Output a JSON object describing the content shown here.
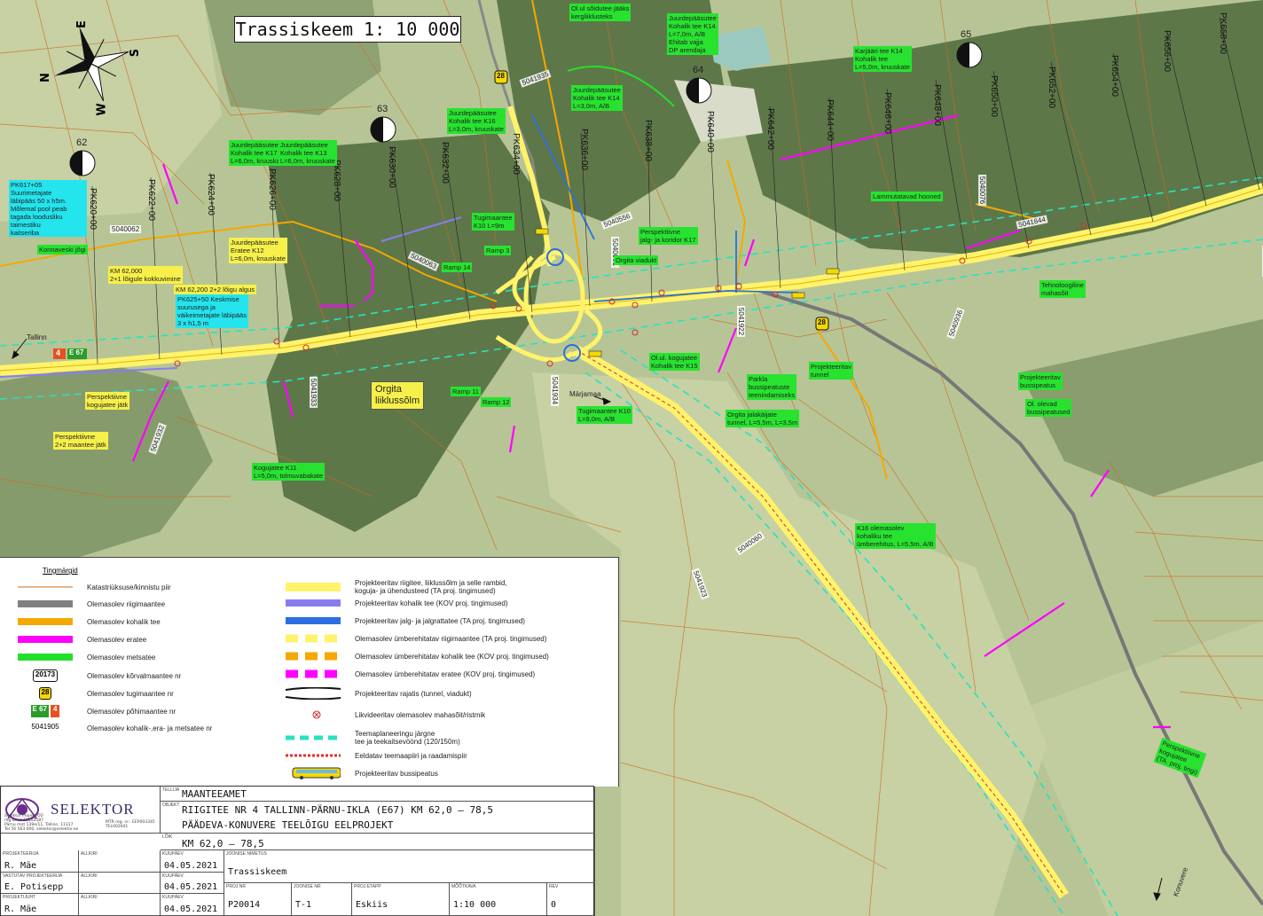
{
  "title": "Trassiskeem 1: 10 000",
  "compass": {
    "n": "N",
    "e": "E",
    "s": "S",
    "w": "W"
  },
  "sheets": [
    "62",
    "63",
    "64",
    "65"
  ],
  "pk_labels": [
    "PK620+00",
    "PK622+00",
    "PK624+00",
    "PK626+00",
    "PK628+00",
    "PK630+00",
    "PK632+00",
    "PK634+00",
    "PK636+00",
    "PK638+00",
    "PK640+00",
    "PK642+00",
    "PK644+00",
    "PK646+00",
    "PK648+00",
    "PK650+00",
    "PK652+00",
    "PK654+00",
    "PK656+00",
    "PK658+00"
  ],
  "road_numbers": [
    "5040062",
    "5040063",
    "5041935",
    "5040556",
    "5041844",
    "5040076",
    "5040061",
    "5041921",
    "5041932",
    "5041933",
    "5041934",
    "5040060",
    "5040936",
    "5041922",
    "5041923"
  ],
  "labels": {
    "pk617": "PK617+05\nSuurimetajate\nläbipääs 50 x h5m.\nMõlemal pool peab\ntagada loodusliku\ntaimestiku\nkaitseriba",
    "konnaveski": "Konnaveski jõgi",
    "km62000": "KM 62,000\n2+1 lõigule kokkuvimine",
    "km62200": "KM 62,200 2+2 lõigu algus",
    "pk625": "PK625+50 Keskmise\nsuurusega ja\nväikeimetajate läbipääs\n3 x h1,5 m",
    "k17a": "Juurdepääsutee\nKohalik tee K17\nL=6,0m, kruuskate",
    "k13": "Juurdepääsutee\nKohalik tee K13\nL=6,0m, kruuskate",
    "k12": "Juurdepääsutee\nEratee K12\nL=6,0m, kruuskate",
    "k16b": "Juurdepääsutee\nKohalik tee K16\nL=3,0m, kruuskate",
    "k14": "Juurdepääsutee\nKohalik tee K14\nL=3,0m, A/B",
    "k14b": "Juurdepääsutee\nKohalik tee K14\nL=7,0m, A/B\nEhitab vajja\nDP arendaja",
    "olul": "Ol.ul sõidutee jääks\nkergliiklusteks",
    "karjaari": "Karjääri tee K14\nKohalik tee\nL=5,0m, kruuskate",
    "tugimaantee": "Tugimaantee\nK10 L=9m",
    "ramp3": "Ramp 3",
    "ramp14": "Ramp 14",
    "perspektiivne_jalg": "Perspektiivne\njalg- ja koridor K17",
    "orgita_viadukt": "Orgita viadukt",
    "lammutatavad": "Lammutatavad hooned",
    "tehnoloogiline": "Tehnoloogiline\nmahasõit",
    "orgita_liiklus": "Orgita\nliiklussõlm",
    "ramp11": "Ramp 11",
    "ramp12": "Ramp 12",
    "tugimaantee_k10": "Tugimaantee K10\nL=9,0m, A/B",
    "kogujatee_k11": "Kogujatee K11\nL=5,0m, tolmuvabakate",
    "olul_kogujatee": "Ol.ul. kogujatee\nKohalik tee K15",
    "parkla": "Parkla\nbussipeatuste\nteenindamiseks",
    "projekteeritav_tunnel": "Projekteeritav\ntunnel",
    "orgita_jala": "Orgita jalakäijate\ntunnel, L=5,5m, L=3,5m",
    "projekteeritav_bp": "Projekteeritav\nbussipeatus",
    "ol_olevad": "Ol. olevad\nbussipeatused",
    "k16": "K16 olemasolev\nkohaliku tee\nümberehitus, L=5,5m, A/B",
    "perspektiivne_kogujatee": "Perspektiivne\nkogujatee jätk",
    "perspektiivne_2p2": "Perspektiivne\n2+2 maantee jätk",
    "perspektiivne_kv": "Perspektiivne\nkogujatee\n(TA. proj. tingi)",
    "tallinn": "Tallinn",
    "marjamaa": "Märjamaa",
    "konuvere": "Konuvere",
    "e67": "E 67",
    "n4": "4",
    "n28": "28"
  },
  "legend": {
    "header": "Tingmärgid",
    "left": [
      "Katastriüksuse/kinnistu piir",
      "Olemasolev riigimaantee",
      "Olemasolev kohalik tee",
      "Olemasolev eratee",
      "Olemasolev metsatee",
      "Olemasolev kõrvalmaantee nr",
      "Olemasolev tugimaantee nr",
      "Olemasolev põhimaantee nr",
      "Olemasolev kohalik-,era- ja metsatee nr"
    ],
    "left_symbols": [
      "",
      "",
      "",
      "",
      "",
      "20173",
      "28",
      "E 67",
      "5041905"
    ],
    "right": [
      "Projekteeritav riigitee, liiklussõlm ja selle rambid,\nkoguja- ja ühendusteed (TA proj. tingimused)",
      "Projekteeritav kohalik tee (KOV proj. tingimused)",
      "Projekteeritav jalg- ja jalgrattatee (TA proj. tingimused)",
      "Olemasolev ümberehitatav riigimaantee (TA proj. tingimused)",
      "Olemasolev ümberehitatav kohalik tee (KOV proj. tingimused)",
      "Olemasolev ümberehitatav eratee (KOV proj. tingimused)",
      "Projekteeritav rajatis (tunnel, viadukt)",
      "Likvideeritav olemasolev mahasõit/ristmik",
      "Teemaplaneeringu järgne\ntee ja teekaitsevöönd (120/150m)",
      "Eeldatav teemaapiiri ja raadamispiir",
      "Projekteeritav bussipeatus"
    ],
    "colors": {
      "katastri": "#d2691e",
      "riigimaantee": "#808080",
      "kohalik": "#f5a800",
      "eratee": "#ff00ff",
      "metsatee": "#22e02a",
      "proj_riigitee": "#fff36b",
      "proj_kohalik": "#8a7cf0",
      "proj_jalg": "#2a6fe0",
      "umber_riigi": "#fff36b",
      "umber_kohalik": "#f5a800",
      "umber_era": "#ff00ff",
      "teemaplaneering": "#27e2c0",
      "teemaapiir": "#e23030"
    }
  },
  "title_block": {
    "company": "SELEKTOR",
    "company_info": "Selektor Projekt OÜ\nreg.kood 12503587\nPärnu mnt 139e/11, Tallinn, 11317\nTel 56 563 000, selektor@selektor.ee",
    "mtr": "MTR reg. nr.: EEP003345\nTEL002641",
    "tellija_label": "TELLIJA",
    "tellija": "MAANTEEAMET",
    "objekt_label": "OBJEKT",
    "objekt1": "RIIGITEE NR 4 TALLINN-PÄRNU-IKLA (E67) KM 62,0 – 78,5",
    "objekt2": "PÄÄDEVA-KONUVERE TEELÕIGU EELPROJEKT",
    "loik_label": "LÕIK",
    "loik": "KM 62,0 – 78,5",
    "projekteerija_label": "PROJEKTEERIJA",
    "allkiri": "ALLKIRI",
    "kuupaev": "KUUPÄEV",
    "projekteerija": "R. Mäe",
    "date1": "04.05.2021",
    "vastutav_label": "VASTUTAV PROJEKTEERIJA",
    "vastutav": "E. Potisepp",
    "date2": "04.05.2021",
    "projektijuht_label": "PROJEKTIJUHT",
    "projektijuht": "R. Mäe",
    "date3": "04.05.2021",
    "joonise_nimetus_label": "JOONISE NIMETUS",
    "joonise_nimetus": "Trassiskeem",
    "proj_nr_label": "PROJ NR",
    "proj_nr": "P20014",
    "joonise_nr_label": "JOONISE NR",
    "joonise_nr": "T-1",
    "proj_etapp_label": "PROJ ETAPP",
    "proj_etapp": "Eskiis",
    "moodkava_label": "MÕÕTKAVA",
    "moodkava": "1:10 000",
    "rev_label": "REV",
    "rev": "0"
  }
}
